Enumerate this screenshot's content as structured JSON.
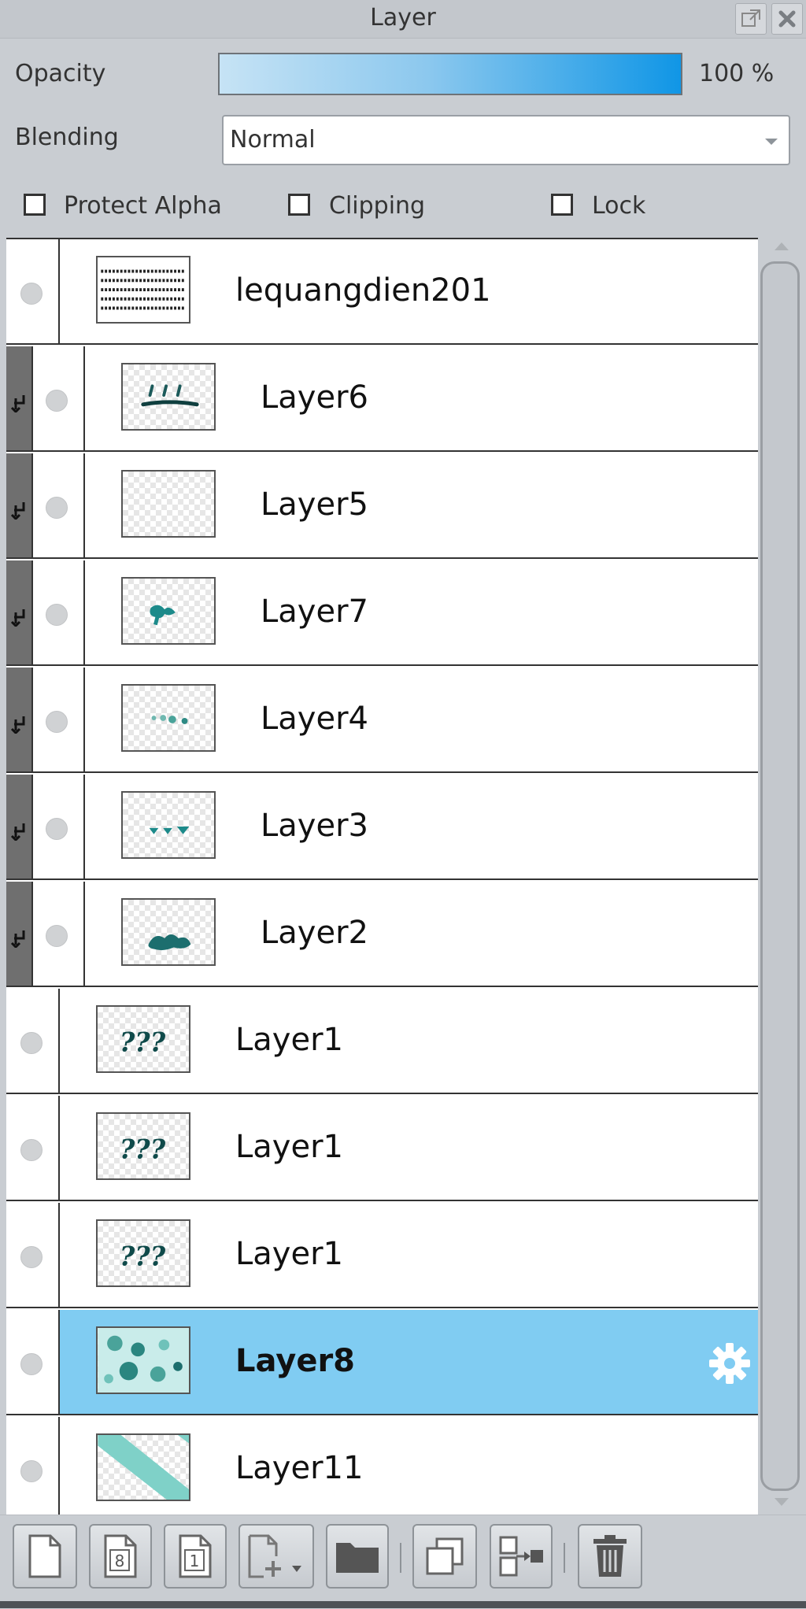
{
  "window": {
    "title": "Layer",
    "popout_icon": "popout-icon",
    "close_icon": "close-icon"
  },
  "opacity": {
    "label": "Opacity",
    "value": "100 %",
    "level_percent": 100
  },
  "blending": {
    "label": "Blending",
    "value": "Normal"
  },
  "options": {
    "protect_alpha": {
      "label": "Protect Alpha",
      "checked": false
    },
    "clipping": {
      "label": "Clipping",
      "checked": false
    },
    "lock": {
      "label": "Lock",
      "checked": false
    }
  },
  "layers": [
    {
      "name": "lequangdien201",
      "clipped": false,
      "selected": false,
      "thumb": "text-logo"
    },
    {
      "name": "Layer6",
      "clipped": true,
      "selected": false,
      "thumb": "strokes"
    },
    {
      "name": "Layer5",
      "clipped": true,
      "selected": false,
      "thumb": "empty"
    },
    {
      "name": "Layer7",
      "clipped": true,
      "selected": false,
      "thumb": "blob"
    },
    {
      "name": "Layer4",
      "clipped": true,
      "selected": false,
      "thumb": "dots"
    },
    {
      "name": "Layer3",
      "clipped": true,
      "selected": false,
      "thumb": "hearts"
    },
    {
      "name": "Layer2",
      "clipped": true,
      "selected": false,
      "thumb": "smudge"
    },
    {
      "name": "Layer1",
      "clipped": false,
      "selected": false,
      "thumb": "question-marks"
    },
    {
      "name": "Layer1",
      "clipped": false,
      "selected": false,
      "thumb": "question-marks"
    },
    {
      "name": "Layer1",
      "clipped": false,
      "selected": false,
      "thumb": "question-marks"
    },
    {
      "name": "Layer8",
      "clipped": false,
      "selected": true,
      "thumb": "spots"
    },
    {
      "name": "Layer11",
      "clipped": false,
      "selected": false,
      "thumb": "diagonal"
    }
  ],
  "toolbar": {
    "buttons": [
      "new-layer-icon",
      "new-8bit-layer-icon",
      "new-1bit-layer-icon",
      "add-layer-menu-icon",
      "folder-icon",
      "duplicate-layer-icon",
      "merge-down-icon",
      "delete-layer-icon"
    ],
    "badge_8": "8",
    "badge_1": "1"
  },
  "colors": {
    "selected_row": "#80ccf2",
    "accent": "#1096e6",
    "clip_strip": "#6f6f6f",
    "teal": "#1c8a8a"
  }
}
